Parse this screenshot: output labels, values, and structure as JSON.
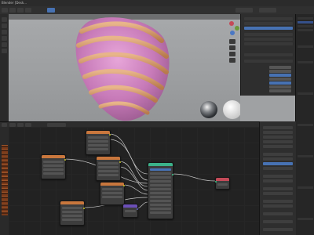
{
  "window": {
    "title": "Blender [Desk..."
  },
  "colors": {
    "viewport_bg": "#a0a2a4",
    "node_header_texture": "#c9773d",
    "node_header_shader": "#3bb28a",
    "node_header_vector": "#6b4fb7",
    "node_header_output": "#c44a58",
    "accent_blue": "#4772b3"
  },
  "icons": [
    "axis-gizmo-icon",
    "zoom-icon",
    "pan-icon",
    "camera-icon",
    "grid-icon"
  ],
  "nodes": [
    {
      "name": "image-texture-node",
      "type": "texture"
    },
    {
      "name": "image-texture-node",
      "type": "texture"
    },
    {
      "name": "image-texture-node",
      "type": "texture"
    },
    {
      "name": "image-texture-node",
      "type": "texture"
    },
    {
      "name": "image-texture-node",
      "type": "texture"
    },
    {
      "name": "mapping-node",
      "type": "vector"
    },
    {
      "name": "principled-bsdf-node",
      "type": "shader"
    },
    {
      "name": "material-output-node",
      "type": "output"
    }
  ]
}
